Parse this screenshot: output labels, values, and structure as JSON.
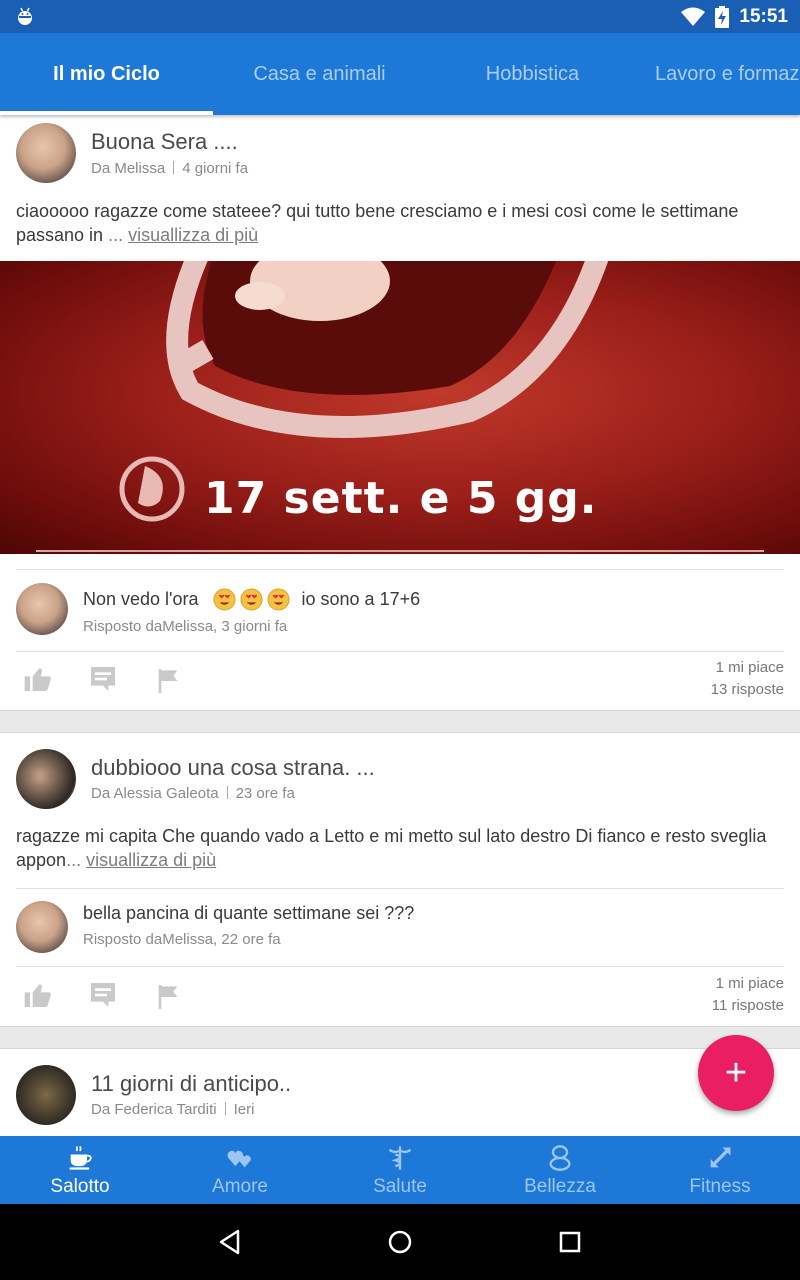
{
  "status_bar": {
    "time": "15:51"
  },
  "tabs": [
    {
      "label": "Il mio Ciclo",
      "active": true
    },
    {
      "label": "Casa e animali",
      "active": false
    },
    {
      "label": "Hobbistica",
      "active": false
    },
    {
      "label": "Lavoro e formaz",
      "active": false
    }
  ],
  "posts": [
    {
      "title": "Buona Sera ....",
      "author": "Da Melissa",
      "time": "4 giorni fa",
      "body": "ciaooooo ragazze come stateee? qui tutto bene cresciamo e i mesi così come le settimane passano in",
      "ellipsis": "...",
      "more": "visuallizza di più",
      "image_caption": "17 sett. e 5 gg.",
      "reply": {
        "text_before": "Non vedo l'ora",
        "text_after": "io sono a 17+6",
        "meta": "Risposto daMelissa, 3 giorni fa"
      },
      "likes": "1 mi piace",
      "replies": "13 risposte"
    },
    {
      "title": "dubbiooo una cosa strana. ...",
      "author": "Da Alessia Galeota",
      "time": "23 ore fa",
      "body": "ragazze mi capita Che quando vado a Letto e mi metto sul lato destro Di fianco e resto sveglia appon",
      "ellipsis": "...",
      "more": "visuallizza di più",
      "reply": {
        "text": "bella pancina di quante settimane sei ???",
        "meta": "Risposto daMelissa, 22 ore fa"
      },
      "likes": "1 mi piace",
      "replies": "11 risposte"
    },
    {
      "title": "11 giorni di anticipo..",
      "author": "Da Federica Tarditi",
      "time": "Ieri"
    }
  ],
  "fab": {
    "label": "+"
  },
  "bottom_nav": [
    {
      "label": "Salotto",
      "icon": "coffee-cup-icon",
      "active": true
    },
    {
      "label": "Amore",
      "icon": "hearts-icon",
      "active": false
    },
    {
      "label": "Salute",
      "icon": "caduceus-icon",
      "active": false
    },
    {
      "label": "Bellezza",
      "icon": "beauty-icon",
      "active": false
    },
    {
      "label": "Fitness",
      "icon": "expand-arrows-icon",
      "active": false
    }
  ],
  "colors": {
    "primary": "#1e78d7",
    "status": "#1a5fb4",
    "fab": "#e91e63"
  }
}
